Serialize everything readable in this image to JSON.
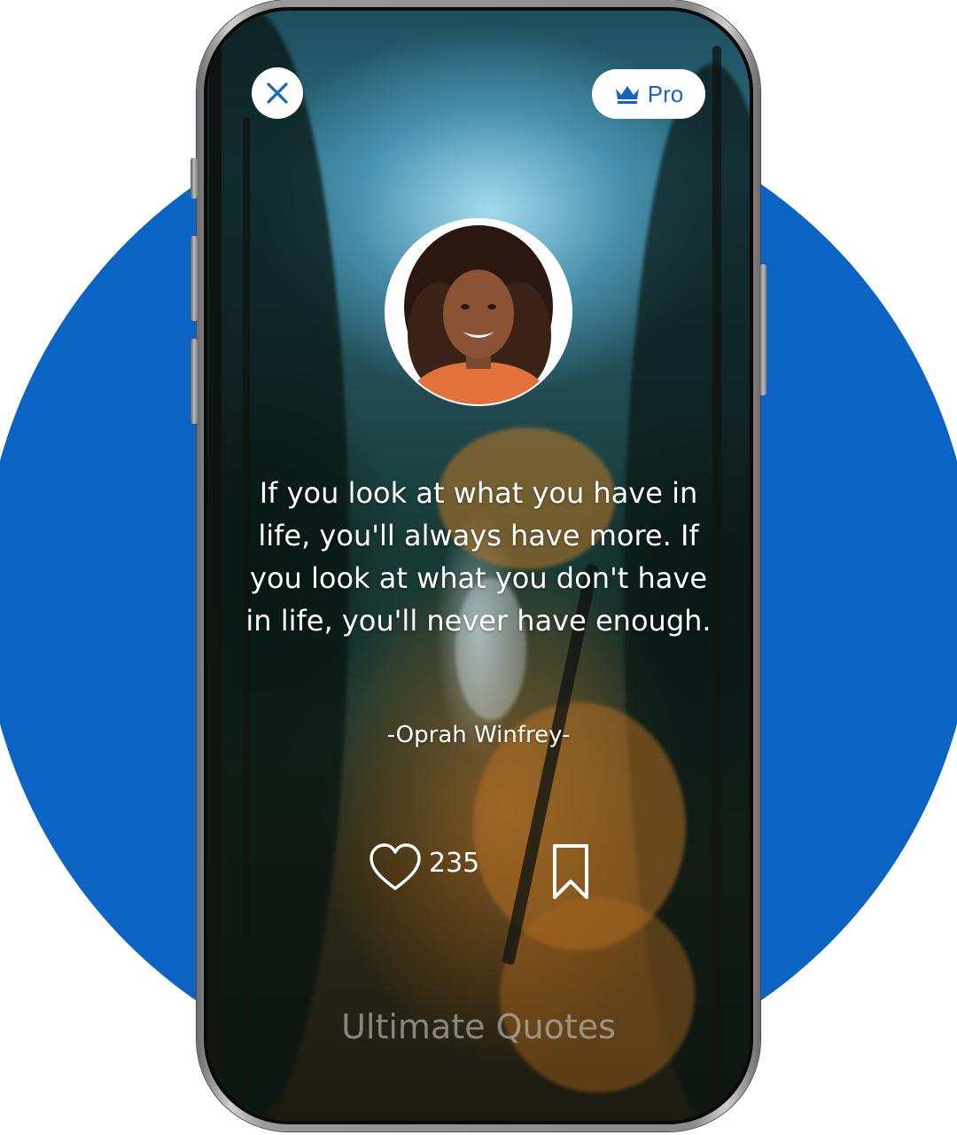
{
  "header": {
    "close_icon": "close-icon",
    "pro_icon": "crown-icon",
    "pro_label": "Pro"
  },
  "quote": {
    "author_avatar": "author-portrait",
    "text": "If you look at what you have in life, you'll always have more. If you look at what you don't have in life, you'll never have enough.",
    "author": "-Oprah Winfrey-"
  },
  "actions": {
    "like_icon": "heart-icon",
    "like_count": "235",
    "bookmark_icon": "bookmark-icon"
  },
  "footer": {
    "brand": "Ultimate Quotes"
  },
  "colors": {
    "accent": "#1565c0",
    "backdrop_circle": "#0b63c4",
    "text": "#ffffff"
  }
}
